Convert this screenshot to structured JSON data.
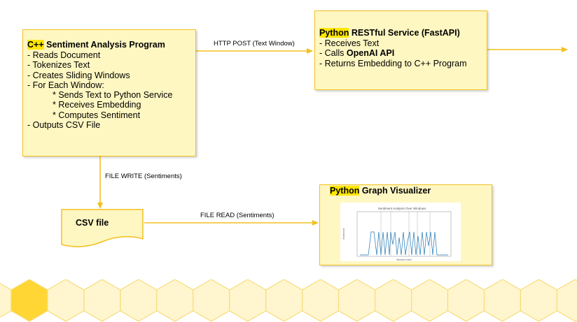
{
  "cpp_program": {
    "title_highlight": "C++",
    "title_rest": " Sentiment Analysis Program",
    "items": [
      "- Reads Document",
      "- Tokenizes Text",
      "- Creates Sliding Windows",
      "- For Each Window:"
    ],
    "sub_items": [
      "* Sends Text to Python Service",
      "* Receives Embedding",
      "* Computes Sentiment"
    ],
    "last_item": "- Outputs CSV File"
  },
  "python_service": {
    "title_highlight": "Python",
    "title_rest": " RESTful Service (FastAPI)",
    "item_1": "- Receives Text",
    "item_2_prefix": "- Calls ",
    "item_2_bold": "OpenAI API",
    "item_3": "- Returns Embedding to C++ Program"
  },
  "csv_file": {
    "label": "CSV file"
  },
  "visualizer": {
    "title_highlight": "Python",
    "title_rest": " Graph Visualizer",
    "thumbnail": {
      "title": "Sentiment Analysis Over Windows",
      "xlabel": "Window Index",
      "ylabel": "Sentiment"
    }
  },
  "edges": {
    "http_post": "HTTP POST (Text Window)",
    "file_write": "FILE WRITE (Sentiments)",
    "file_read": "FILE READ (Sentiments)"
  },
  "colors": {
    "box_fill": "#fff7c2",
    "box_border": "#f2c01e",
    "highlight": "#ffe600",
    "arrow": "#f2c01e",
    "hex_fill": "#fff6cf",
    "hex_accent": "#ffd633"
  }
}
